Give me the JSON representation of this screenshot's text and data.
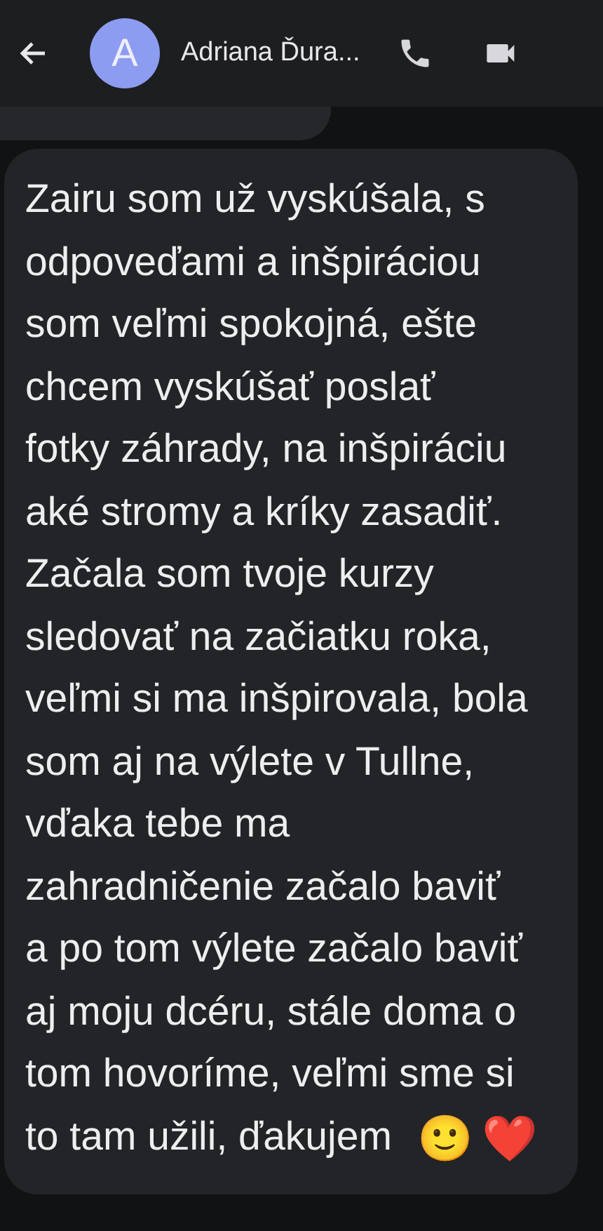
{
  "header": {
    "avatar_letter": "A",
    "contact_name": "Adriana Ďura..."
  },
  "message": {
    "lines": [
      "Zairu som už vyskúšala, s",
      "odpoveďami a inšpiráciou",
      "som veľmi spokojná, ešte",
      "chcem vyskúšať poslať",
      "fotky záhrady, na inšpiráciu",
      "aké stromy a kríky zasadiť.",
      "Začala som tvoje kurzy",
      "sledovať na začiatku roka,",
      "veľmi si ma inšpirovala, bola",
      "som aj na výlete v Tullne,",
      "vďaka tebe ma",
      "zahradničenie začalo baviť",
      "a po tom výlete začalo baviť",
      "aj moju dcéru, stále doma o",
      "tom hovoríme, veľmi sme si",
      "to tam užili, ďakujem"
    ],
    "end_emoji": [
      "🙂",
      "❤️"
    ]
  }
}
